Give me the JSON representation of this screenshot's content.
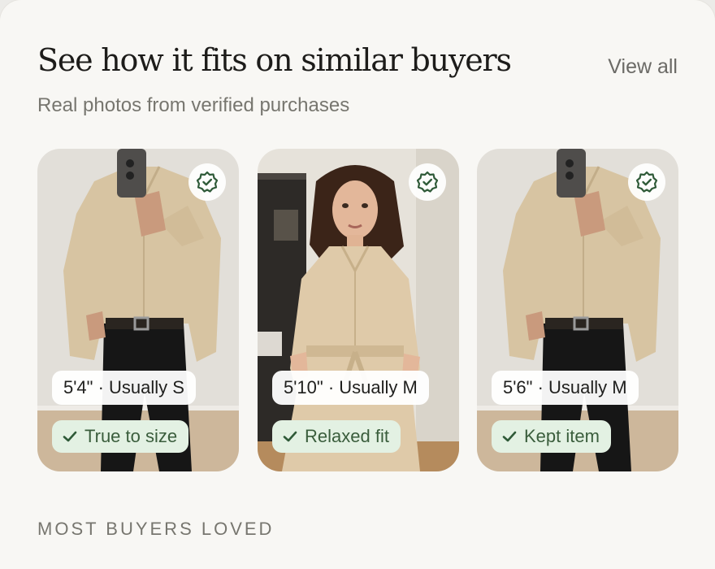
{
  "header": {
    "title": "See how it fits on similar buyers",
    "view_all": "View all",
    "subtitle": "Real photos from verified purchases"
  },
  "cards": [
    {
      "size": "5'4\" · Usually S",
      "fit": "True to size",
      "badge_icon": "verified-check-icon",
      "fit_icon": "checkmark-icon"
    },
    {
      "size": "5'10\" · Usually M",
      "fit": "Relaxed fit",
      "badge_icon": "verified-check-icon",
      "fit_icon": "checkmark-icon"
    },
    {
      "size": "5'6\" · Usually M",
      "fit": "Kept item",
      "badge_icon": "verified-check-icon",
      "fit_icon": "checkmark-icon"
    }
  ],
  "section": {
    "label": "MOST BUYERS LOVED"
  },
  "colors": {
    "accent_green": "#2f5a38",
    "pill_green_bg": "#e3f1e3",
    "shirt_beige": "#d8c5a4"
  }
}
